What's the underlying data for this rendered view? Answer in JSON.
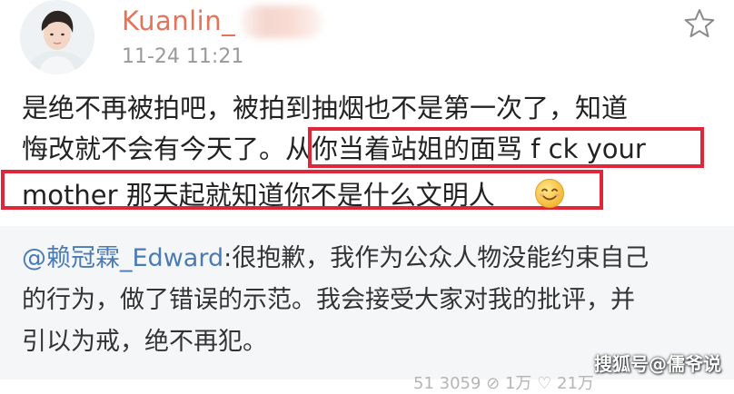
{
  "post": {
    "username": "Kuanlin_",
    "timestamp": "11-24 11:21",
    "body": {
      "line1": "是绝不再被拍吧，被拍到抽烟也不是第一次了，知道",
      "line2_start": "悔改就不会有今天了。",
      "line2_highlight": "从你当着站姐的面骂 f ck your",
      "line3": "mother 那天起就知道你不是什么文明人"
    },
    "icons": {
      "favorite": "star-outline-icon",
      "emoji": "smile-emoji-icon"
    }
  },
  "repost": {
    "mention": "@赖冠霖_Edward",
    "line1_text": ":很抱歉，我作为公众人物没能约束自己",
    "line2": "的行为，做了错误的示范。我会接受大家对我的批评，并",
    "line3": "引以为戒，绝不再犯。",
    "stats": "51 3059  ⊘ 1万  ♡ 21万"
  },
  "watermark": "搜狐号@儒爷说",
  "colors": {
    "username": "#e5735c",
    "timestamp": "#9a9a9a",
    "mention": "#4a7bb4",
    "highlight_box": "#e0273a",
    "repost_bg": "#f5f6f8"
  }
}
